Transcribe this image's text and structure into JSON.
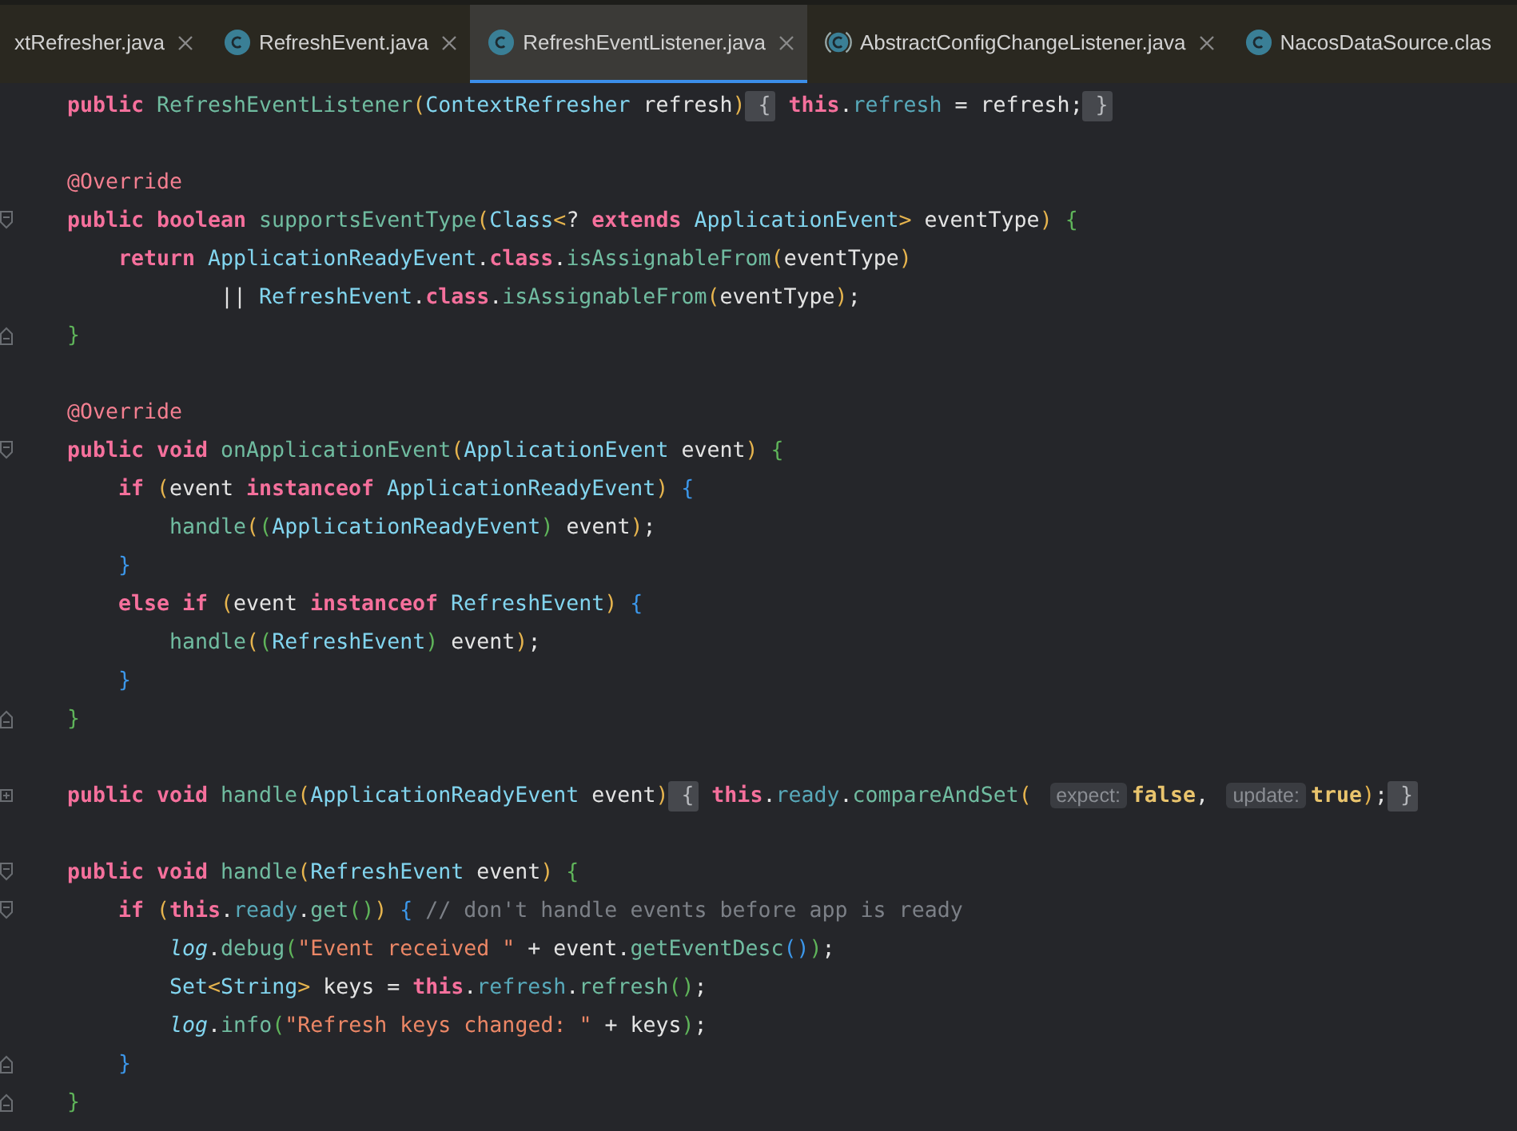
{
  "tabs": [
    {
      "label": "xtRefresher.java",
      "selected": false,
      "closable": true
    },
    {
      "label": "RefreshEvent.java",
      "kind": "class",
      "selected": false,
      "closable": true
    },
    {
      "label": "RefreshEventListener.java",
      "kind": "class",
      "selected": true,
      "closable": true
    },
    {
      "label": "AbstractConfigChangeListener.java",
      "kind": "abstract-class",
      "selected": false,
      "closable": true
    },
    {
      "label": "NacosDataSource.clas",
      "kind": "class",
      "selected": false,
      "closable": false
    }
  ],
  "editor": {
    "lines": [
      {
        "kind": "code",
        "tokens": [
          {
            "kind": "kw",
            "text": "public"
          },
          {
            "kind": "fn",
            "text": "RefreshEventListener",
            "space_before": true
          },
          {
            "kind": "p1",
            "text": "("
          },
          {
            "kind": "type",
            "text": "ContextRefresher"
          },
          {
            "kind": "var",
            "text": "refresh",
            "space_before": true
          },
          {
            "kind": "p1",
            "text": ")"
          },
          {
            "kind": "fold",
            "text": "{",
            "space_before": true
          },
          {
            "kind": "kw",
            "text": "this",
            "space_before": true
          },
          {
            "kind": "op",
            "text": "."
          },
          {
            "kind": "field",
            "text": "refresh"
          },
          {
            "kind": "op",
            "text": "=",
            "space_before": true
          },
          {
            "kind": "var",
            "text": "refresh",
            "space_before": true
          },
          {
            "kind": "op",
            "text": ";"
          },
          {
            "kind": "fold",
            "text": "}",
            "space_before": true
          }
        ]
      },
      {
        "kind": "blank"
      },
      {
        "kind": "code",
        "tokens": [
          {
            "kind": "ann",
            "text": "@Override"
          }
        ]
      },
      {
        "kind": "code",
        "gutter": {
          "kind": "fold-open"
        },
        "tokens": [
          {
            "kind": "kw",
            "text": "public"
          },
          {
            "kind": "kw",
            "text": "boolean",
            "space_before": true
          },
          {
            "kind": "fn",
            "text": "supportsEventType",
            "space_before": true
          },
          {
            "kind": "p1",
            "text": "("
          },
          {
            "kind": "type",
            "text": "Class"
          },
          {
            "kind": "p1",
            "text": "<"
          },
          {
            "kind": "op",
            "text": "?"
          },
          {
            "kind": "kw",
            "text": "extends",
            "space_before": true
          },
          {
            "kind": "type",
            "text": "ApplicationEvent",
            "space_before": true
          },
          {
            "kind": "p1",
            "text": ">"
          },
          {
            "kind": "var",
            "text": "eventType",
            "space_before": true
          },
          {
            "kind": "p1",
            "text": ")"
          },
          {
            "kind": "p2",
            "text": "{",
            "space_before": true
          }
        ],
        "children": [
          {
            "kind": "code",
            "tokens": [
              {
                "kind": "kw",
                "text": "return"
              },
              {
                "kind": "type",
                "text": "ApplicationReadyEvent",
                "space_before": true
              },
              {
                "kind": "op",
                "text": "."
              },
              {
                "kind": "kw",
                "text": "class"
              },
              {
                "kind": "op",
                "text": "."
              },
              {
                "kind": "fn",
                "text": "isAssignableFrom"
              },
              {
                "kind": "p1",
                "text": "("
              },
              {
                "kind": "var",
                "text": "eventType"
              },
              {
                "kind": "p1",
                "text": ")"
              }
            ],
            "children": [
              {
                "kind": "continuation",
                "tokens": [
                  {
                    "kind": "op",
                    "text": "||"
                  },
                  {
                    "kind": "type",
                    "text": "RefreshEvent",
                    "space_before": true
                  },
                  {
                    "kind": "op",
                    "text": "."
                  },
                  {
                    "kind": "kw",
                    "text": "class"
                  },
                  {
                    "kind": "op",
                    "text": "."
                  },
                  {
                    "kind": "fn",
                    "text": "isAssignableFrom"
                  },
                  {
                    "kind": "p1",
                    "text": "("
                  },
                  {
                    "kind": "var",
                    "text": "eventType"
                  },
                  {
                    "kind": "p1",
                    "text": ")"
                  },
                  {
                    "kind": "op",
                    "text": ";"
                  }
                ]
              }
            ]
          }
        ]
      },
      {
        "kind": "code",
        "gutter": {
          "kind": "fold-close"
        },
        "tokens": [
          {
            "kind": "p2",
            "text": "}"
          }
        ]
      },
      {
        "kind": "blank"
      },
      {
        "kind": "code",
        "tokens": [
          {
            "kind": "ann",
            "text": "@Override"
          }
        ]
      },
      {
        "kind": "code",
        "gutter": {
          "kind": "fold-open"
        },
        "tokens": [
          {
            "kind": "kw",
            "text": "public"
          },
          {
            "kind": "kw",
            "text": "void",
            "space_before": true
          },
          {
            "kind": "fn",
            "text": "onApplicationEvent",
            "space_before": true
          },
          {
            "kind": "p1",
            "text": "("
          },
          {
            "kind": "type",
            "text": "ApplicationEvent"
          },
          {
            "kind": "var",
            "text": "event",
            "space_before": true
          },
          {
            "kind": "p1",
            "text": ")"
          },
          {
            "kind": "p2",
            "text": "{",
            "space_before": true
          }
        ],
        "children": [
          {
            "kind": "code",
            "tokens": [
              {
                "kind": "kw",
                "text": "if"
              },
              {
                "kind": "p1",
                "text": "(",
                "space_before": true
              },
              {
                "kind": "var",
                "text": "event"
              },
              {
                "kind": "kw",
                "text": "instanceof",
                "space_before": true
              },
              {
                "kind": "type",
                "text": "ApplicationReadyEvent",
                "space_before": true
              },
              {
                "kind": "p1",
                "text": ")"
              },
              {
                "kind": "p3",
                "text": "{",
                "space_before": true
              }
            ],
            "children": [
              {
                "kind": "code",
                "tokens": [
                  {
                    "kind": "fn",
                    "text": "handle"
                  },
                  {
                    "kind": "p1",
                    "text": "("
                  },
                  {
                    "kind": "p2",
                    "text": "("
                  },
                  {
                    "kind": "type",
                    "text": "ApplicationReadyEvent"
                  },
                  {
                    "kind": "p2",
                    "text": ")"
                  },
                  {
                    "kind": "var",
                    "text": "event",
                    "space_before": true
                  },
                  {
                    "kind": "p1",
                    "text": ")"
                  },
                  {
                    "kind": "op",
                    "text": ";"
                  }
                ]
              }
            ]
          },
          {
            "kind": "code",
            "tokens": [
              {
                "kind": "p3",
                "text": "}"
              }
            ]
          },
          {
            "kind": "code",
            "tokens": [
              {
                "kind": "kw",
                "text": "else"
              },
              {
                "kind": "kw",
                "text": "if",
                "space_before": true
              },
              {
                "kind": "p1",
                "text": "(",
                "space_before": true
              },
              {
                "kind": "var",
                "text": "event"
              },
              {
                "kind": "kw",
                "text": "instanceof",
                "space_before": true
              },
              {
                "kind": "type",
                "text": "RefreshEvent",
                "space_before": true
              },
              {
                "kind": "p1",
                "text": ")"
              },
              {
                "kind": "p3",
                "text": "{",
                "space_before": true
              }
            ],
            "children": [
              {
                "kind": "code",
                "tokens": [
                  {
                    "kind": "fn",
                    "text": "handle"
                  },
                  {
                    "kind": "p1",
                    "text": "("
                  },
                  {
                    "kind": "p2",
                    "text": "("
                  },
                  {
                    "kind": "type",
                    "text": "RefreshEvent"
                  },
                  {
                    "kind": "p2",
                    "text": ")"
                  },
                  {
                    "kind": "var",
                    "text": "event",
                    "space_before": true
                  },
                  {
                    "kind": "p1",
                    "text": ")"
                  },
                  {
                    "kind": "op",
                    "text": ";"
                  }
                ]
              }
            ]
          },
          {
            "kind": "code",
            "tokens": [
              {
                "kind": "p3",
                "text": "}"
              }
            ]
          }
        ]
      },
      {
        "kind": "code",
        "gutter": {
          "kind": "fold-close"
        },
        "tokens": [
          {
            "kind": "p2",
            "text": "}"
          }
        ]
      },
      {
        "kind": "blank"
      },
      {
        "kind": "code",
        "gutter": {
          "kind": "fold-collapsed"
        },
        "tokens": [
          {
            "kind": "kw",
            "text": "public"
          },
          {
            "kind": "kw",
            "text": "void",
            "space_before": true
          },
          {
            "kind": "fn",
            "text": "handle",
            "space_before": true
          },
          {
            "kind": "p1",
            "text": "("
          },
          {
            "kind": "type",
            "text": "ApplicationReadyEvent"
          },
          {
            "kind": "var",
            "text": "event",
            "space_before": true
          },
          {
            "kind": "p1",
            "text": ")"
          },
          {
            "kind": "fold",
            "text": "{",
            "space_before": true
          },
          {
            "kind": "kw",
            "text": "this",
            "space_before": true
          },
          {
            "kind": "op",
            "text": "."
          },
          {
            "kind": "field",
            "text": "ready"
          },
          {
            "kind": "op",
            "text": "."
          },
          {
            "kind": "fn",
            "text": "compareAndSet"
          },
          {
            "kind": "p1",
            "text": "("
          },
          {
            "kind": "hint",
            "text": "expect:",
            "space_before": true
          },
          {
            "kind": "lit",
            "text": "false"
          },
          {
            "kind": "op",
            "text": ","
          },
          {
            "kind": "hint",
            "text": "update:",
            "space_before": true
          },
          {
            "kind": "lit",
            "text": "true"
          },
          {
            "kind": "p1",
            "text": ")"
          },
          {
            "kind": "op",
            "text": ";"
          },
          {
            "kind": "fold",
            "text": "}",
            "space_before": true
          }
        ]
      },
      {
        "kind": "blank"
      },
      {
        "kind": "code",
        "gutter": {
          "kind": "fold-open"
        },
        "tokens": [
          {
            "kind": "kw",
            "text": "public"
          },
          {
            "kind": "kw",
            "text": "void",
            "space_before": true
          },
          {
            "kind": "fn",
            "text": "handle",
            "space_before": true
          },
          {
            "kind": "p1",
            "text": "("
          },
          {
            "kind": "type",
            "text": "RefreshEvent"
          },
          {
            "kind": "var",
            "text": "event",
            "space_before": true
          },
          {
            "kind": "p1",
            "text": ")"
          },
          {
            "kind": "p2",
            "text": "{",
            "space_before": true
          }
        ],
        "children": [
          {
            "kind": "code",
            "gutter": {
              "kind": "fold-open"
            },
            "tokens": [
              {
                "kind": "kw",
                "text": "if"
              },
              {
                "kind": "p1",
                "text": "(",
                "space_before": true
              },
              {
                "kind": "kw",
                "text": "this"
              },
              {
                "kind": "op",
                "text": "."
              },
              {
                "kind": "field",
                "text": "ready"
              },
              {
                "kind": "op",
                "text": "."
              },
              {
                "kind": "fn",
                "text": "get"
              },
              {
                "kind": "p2",
                "text": "()"
              },
              {
                "kind": "p1",
                "text": ")"
              },
              {
                "kind": "p3",
                "text": "{",
                "space_before": true
              },
              {
                "kind": "cmt",
                "text": "// don't handle events before app is ready",
                "space_before": true
              }
            ],
            "children": [
              {
                "kind": "code",
                "tokens": [
                  {
                    "kind": "log",
                    "text": "log"
                  },
                  {
                    "kind": "op",
                    "text": "."
                  },
                  {
                    "kind": "fn",
                    "text": "debug"
                  },
                  {
                    "kind": "p2",
                    "text": "("
                  },
                  {
                    "kind": "str",
                    "text": "\"Event received \""
                  },
                  {
                    "kind": "op",
                    "text": "+",
                    "space_before": true
                  },
                  {
                    "kind": "var",
                    "text": "event",
                    "space_before": true
                  },
                  {
                    "kind": "op",
                    "text": "."
                  },
                  {
                    "kind": "fn",
                    "text": "getEventDesc"
                  },
                  {
                    "kind": "p3",
                    "text": "()"
                  },
                  {
                    "kind": "p2",
                    "text": ")"
                  },
                  {
                    "kind": "op",
                    "text": ";"
                  }
                ]
              },
              {
                "kind": "code",
                "tokens": [
                  {
                    "kind": "type",
                    "text": "Set"
                  },
                  {
                    "kind": "p1",
                    "text": "<"
                  },
                  {
                    "kind": "type",
                    "text": "String"
                  },
                  {
                    "kind": "p1",
                    "text": ">"
                  },
                  {
                    "kind": "var",
                    "text": "keys",
                    "space_before": true
                  },
                  {
                    "kind": "op",
                    "text": "=",
                    "space_before": true
                  },
                  {
                    "kind": "kw",
                    "text": "this",
                    "space_before": true
                  },
                  {
                    "kind": "op",
                    "text": "."
                  },
                  {
                    "kind": "field",
                    "text": "refresh"
                  },
                  {
                    "kind": "op",
                    "text": "."
                  },
                  {
                    "kind": "fn",
                    "text": "refresh"
                  },
                  {
                    "kind": "p2",
                    "text": "()"
                  },
                  {
                    "kind": "op",
                    "text": ";"
                  }
                ]
              },
              {
                "kind": "code",
                "tokens": [
                  {
                    "kind": "log",
                    "text": "log"
                  },
                  {
                    "kind": "op",
                    "text": "."
                  },
                  {
                    "kind": "fn",
                    "text": "info"
                  },
                  {
                    "kind": "p2",
                    "text": "("
                  },
                  {
                    "kind": "str",
                    "text": "\"Refresh keys changed: \""
                  },
                  {
                    "kind": "op",
                    "text": "+",
                    "space_before": true
                  },
                  {
                    "kind": "var",
                    "text": "keys",
                    "space_before": true
                  },
                  {
                    "kind": "p2",
                    "text": ")"
                  },
                  {
                    "kind": "op",
                    "text": ";"
                  }
                ]
              }
            ]
          },
          {
            "kind": "code",
            "gutter": {
              "kind": "fold-close"
            },
            "tokens": [
              {
                "kind": "p3",
                "text": "}"
              }
            ]
          }
        ]
      },
      {
        "kind": "code",
        "gutter": {
          "kind": "fold-close"
        },
        "tokens": [
          {
            "kind": "p2",
            "text": "}"
          }
        ]
      }
    ]
  }
}
